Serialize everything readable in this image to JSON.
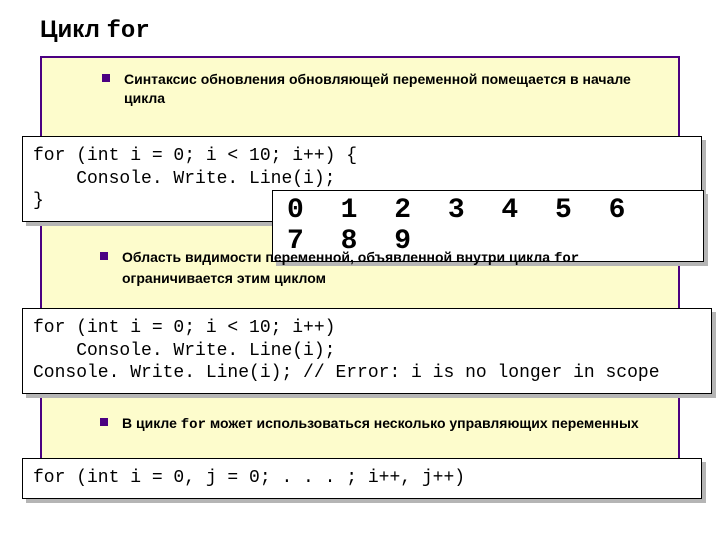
{
  "title_main": "Цикл ",
  "title_mono": "for",
  "bullets": {
    "b1": "Синтаксис обновления обновляющей переменной помещается в начале цикла",
    "b2_a": "Область видимости переменной, объявленной внутри цикла ",
    "b2_mono": "for",
    "b2_b": " ограничивается этим циклом",
    "b3_a": "В цикле ",
    "b3_mono": "for",
    "b3_b": " может использоваться несколько управляющих переменных"
  },
  "code": {
    "c1": "for (int i = 0; i < 10; i++) {\n    Console. Write. Line(i);\n}",
    "output": "0 1 2 3 4 5 6 7 8 9",
    "c2": "for (int i = 0; i < 10; i++)\n    Console. Write. Line(i);\nConsole. Write. Line(i); // Error: i is no longer in scope",
    "c3": "for (int i = 0, j = 0; . . . ; i++, j++)"
  }
}
